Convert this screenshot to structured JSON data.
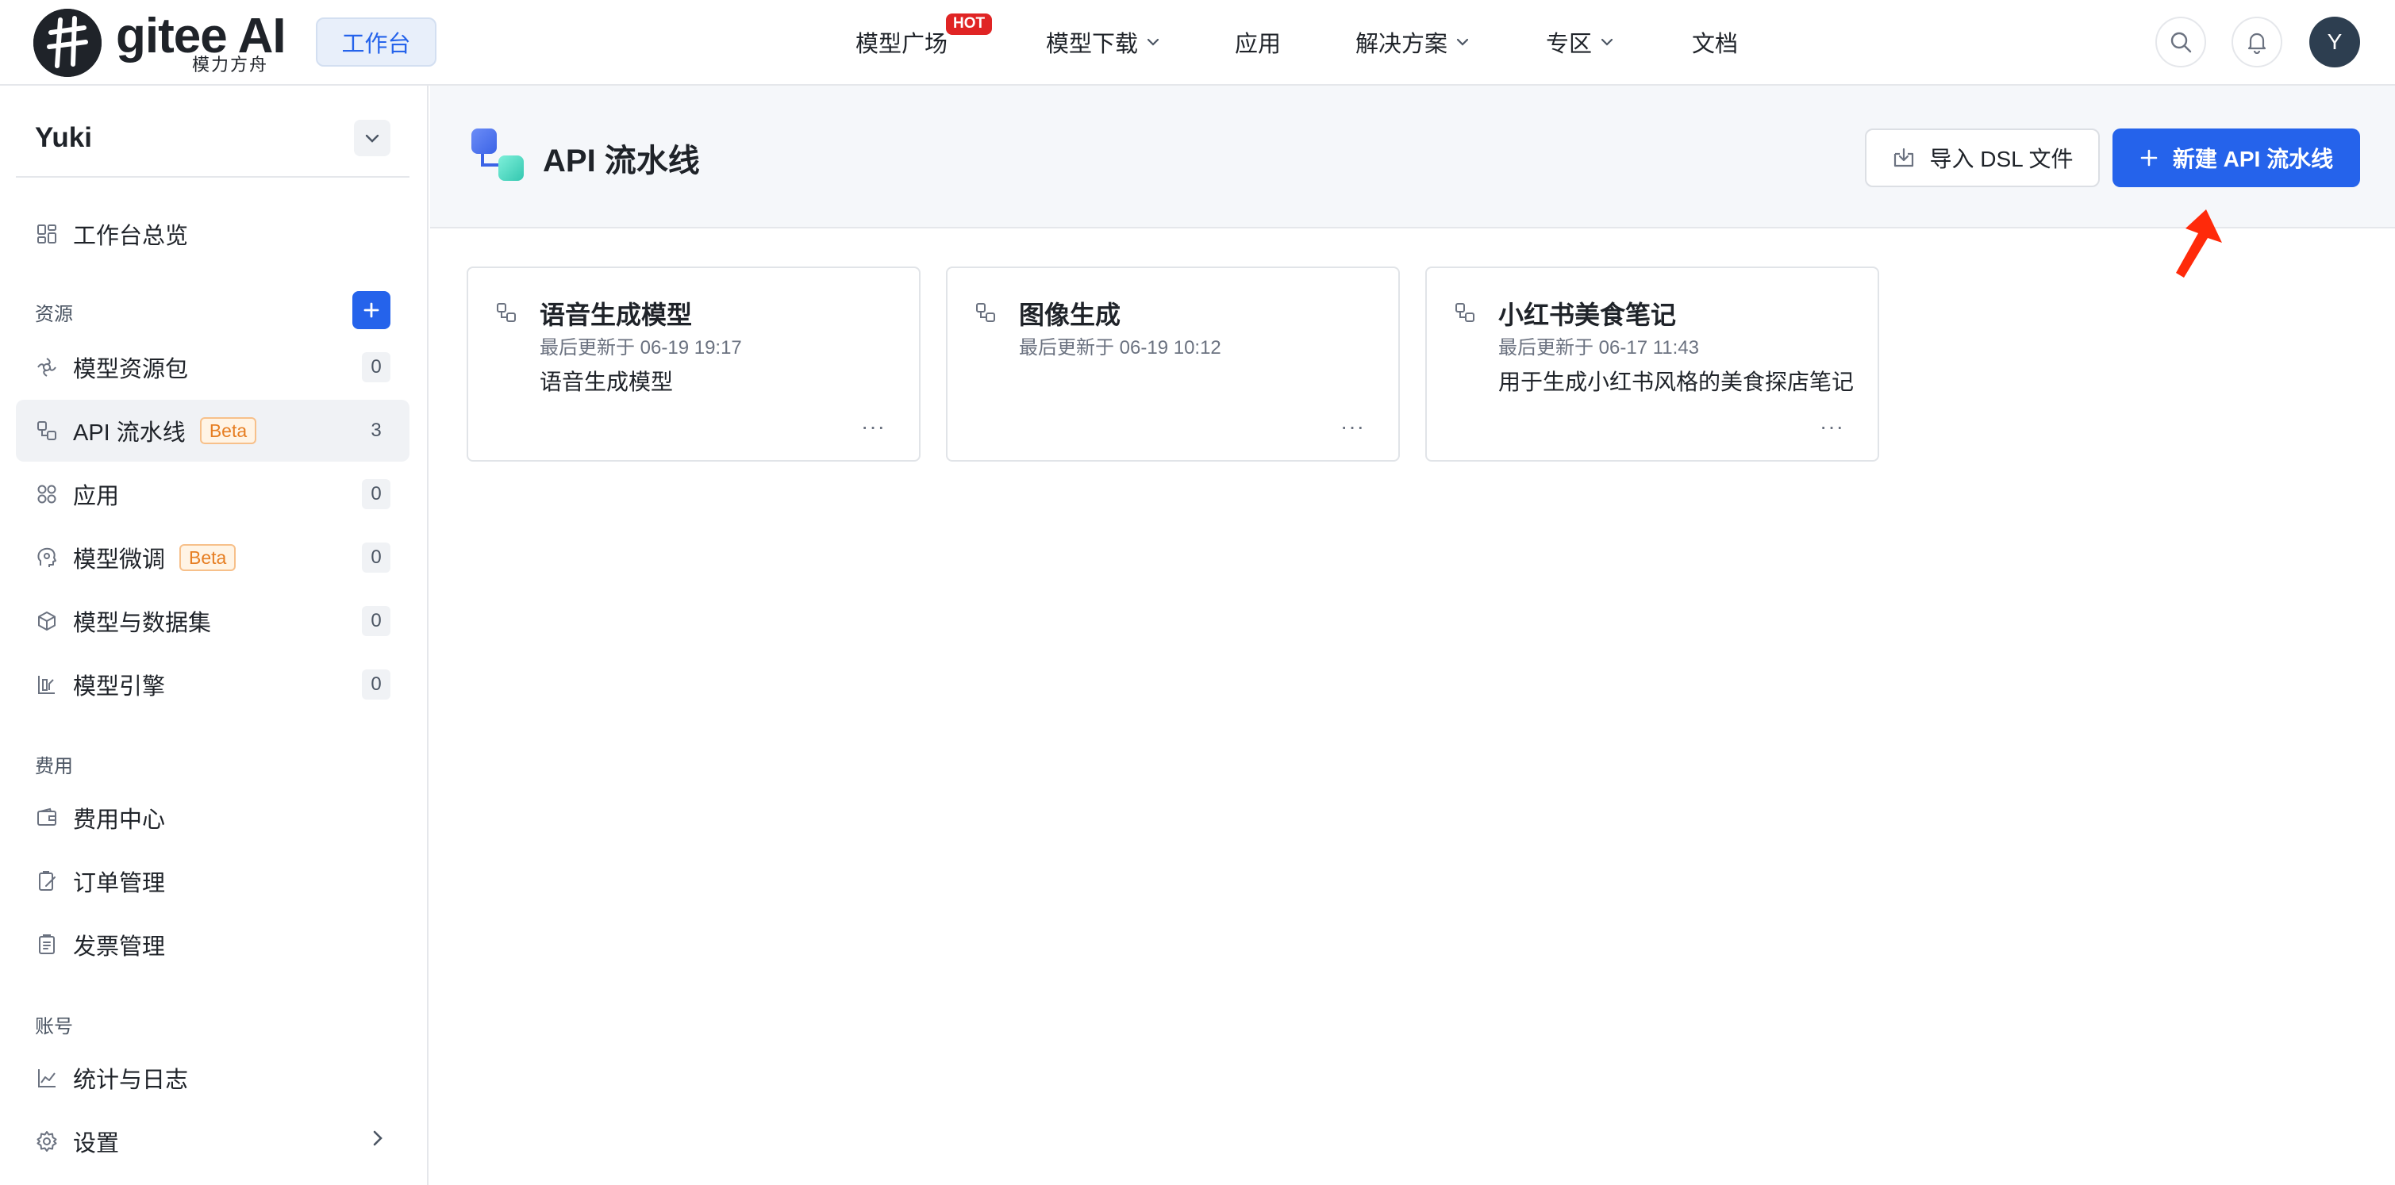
{
  "brand": {
    "name": "gitee AI",
    "subtitle": "模力方舟"
  },
  "topbar": {
    "workspace_label": "工作台",
    "nav": [
      {
        "label": "模型广场",
        "badge": "HOT"
      },
      {
        "label": "模型下载",
        "dropdown": true
      },
      {
        "label": "应用"
      },
      {
        "label": "解决方案",
        "dropdown": true
      },
      {
        "label": "专区",
        "dropdown": true
      },
      {
        "label": "文档"
      }
    ],
    "avatar_initial": "Y"
  },
  "sidebar": {
    "user_name": "Yuki",
    "overview_label": "工作台总览",
    "sections": {
      "resources": "资源",
      "billing": "费用",
      "account": "账号"
    },
    "resource_items": [
      {
        "label": "模型资源包",
        "count": "0",
        "icon": "package-icon"
      },
      {
        "label": "API 流水线",
        "badge": "Beta",
        "count": "3",
        "icon": "pipeline-icon",
        "active": true
      },
      {
        "label": "应用",
        "count": "0",
        "icon": "apps-icon"
      },
      {
        "label": "模型微调",
        "badge": "Beta",
        "count": "0",
        "icon": "brain-icon"
      },
      {
        "label": "模型与数据集",
        "count": "0",
        "icon": "cube-icon"
      },
      {
        "label": "模型引擎",
        "count": "0",
        "icon": "engine-icon"
      }
    ],
    "billing_items": [
      {
        "label": "费用中心",
        "icon": "wallet-icon"
      },
      {
        "label": "订单管理",
        "icon": "order-icon"
      },
      {
        "label": "发票管理",
        "icon": "invoice-icon"
      }
    ],
    "account_items": [
      {
        "label": "统计与日志",
        "icon": "chart-icon"
      },
      {
        "label": "设置",
        "icon": "gear-icon"
      }
    ]
  },
  "main": {
    "title": "API 流水线",
    "import_button": "导入 DSL 文件",
    "new_button": "新建 API 流水线",
    "cards": [
      {
        "title": "语音生成模型",
        "updated": "最后更新于 06-19 19:17",
        "description": "语音生成模型"
      },
      {
        "title": "图像生成",
        "updated": "最后更新于 06-19 10:12",
        "description": ""
      },
      {
        "title": "小红书美食笔记",
        "updated": "最后更新于 06-17 11:43",
        "description": "用于生成小红书风格的美食探店笔记"
      }
    ],
    "more_glyph": "···"
  },
  "colors": {
    "accent": "#2563eb",
    "hot": "#e02424",
    "beta_text": "#e67e22",
    "pointer": "#ff2a0a"
  }
}
